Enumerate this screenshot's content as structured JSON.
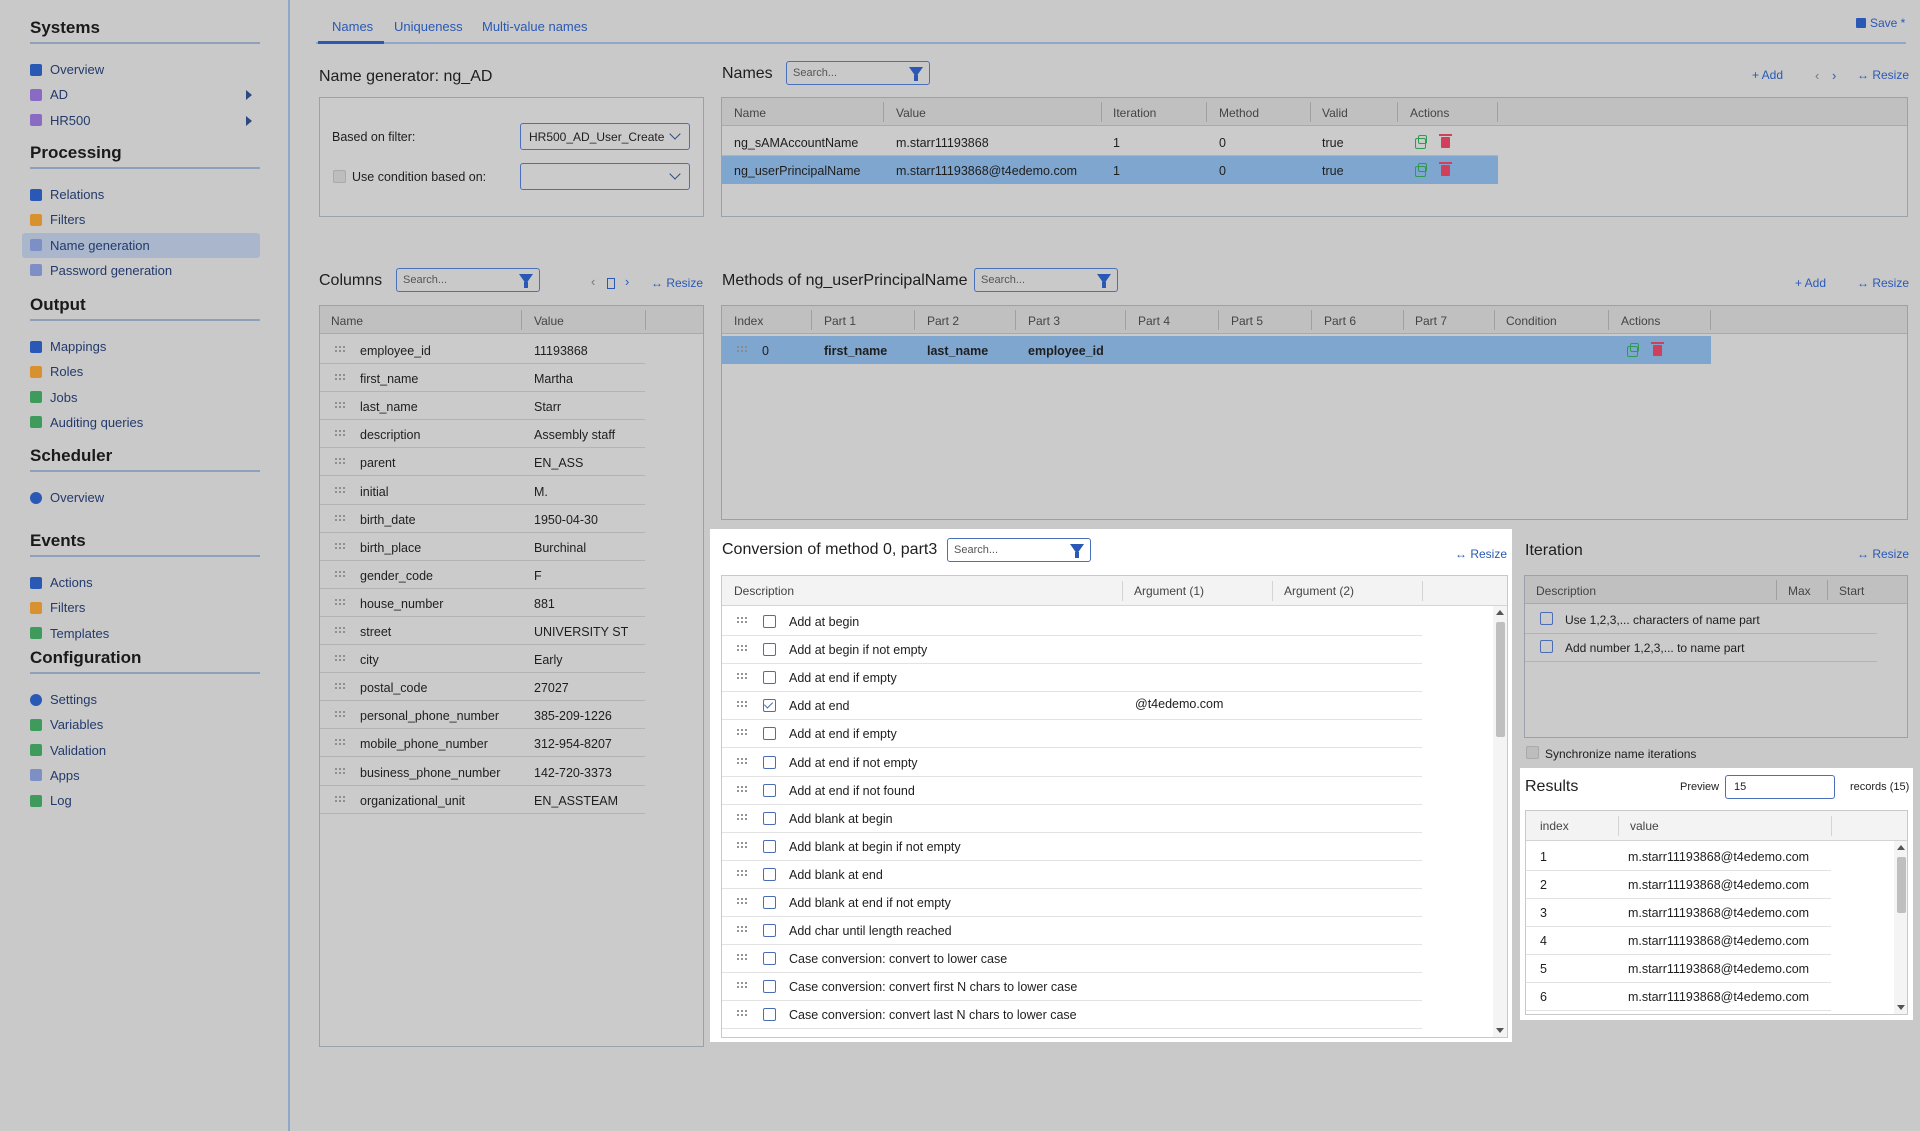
{
  "sidebar": {
    "sections": [
      {
        "title": "Systems",
        "items": [
          {
            "label": "Overview",
            "icon": "wrench-icon"
          },
          {
            "label": "AD",
            "icon": "users-icon",
            "arrow": true
          },
          {
            "label": "HR500",
            "icon": "users-icon",
            "arrow": true
          }
        ]
      },
      {
        "title": "Processing",
        "items": [
          {
            "label": "Relations",
            "icon": "relations-icon"
          },
          {
            "label": "Filters",
            "icon": "filter-icon"
          },
          {
            "label": "Name generation",
            "icon": "edit-icon",
            "active": true
          },
          {
            "label": "Password generation",
            "icon": "edit-icon"
          }
        ]
      },
      {
        "title": "Output",
        "items": [
          {
            "label": "Mappings",
            "icon": "mapping-icon"
          },
          {
            "label": "Roles",
            "icon": "filter-icon"
          },
          {
            "label": "Jobs",
            "icon": "document-icon"
          },
          {
            "label": "Auditing queries",
            "icon": "document-icon"
          }
        ]
      },
      {
        "title": "Scheduler",
        "items": [
          {
            "label": "Overview",
            "icon": "clock-icon"
          }
        ]
      },
      {
        "title": "Events",
        "items": [
          {
            "label": "Actions",
            "icon": "wrench-icon"
          },
          {
            "label": "Filters",
            "icon": "filter-icon"
          },
          {
            "label": "Templates",
            "icon": "document-icon"
          }
        ]
      },
      {
        "title": "Configuration",
        "items": [
          {
            "label": "Settings",
            "icon": "gear-icon"
          },
          {
            "label": "Variables",
            "icon": "document-icon"
          },
          {
            "label": "Validation",
            "icon": "document-icon"
          },
          {
            "label": "Apps",
            "icon": "edit-icon"
          },
          {
            "label": "Log",
            "icon": "document-icon"
          }
        ]
      }
    ]
  },
  "tabs": [
    "Names",
    "Uniqueness",
    "Multi-value names"
  ],
  "save_label": "Save *",
  "generator": {
    "title": "Name generator: ng_AD",
    "based_on_filter_label": "Based on filter:",
    "based_on_filter_value": "HR500_AD_User_Create",
    "use_condition_label": "Use condition based on:",
    "use_condition_value": ""
  },
  "names": {
    "title": "Names",
    "search_placeholder": "Search...",
    "add_label": "+ Add",
    "resize_label": "↔ Resize",
    "headers": [
      "Name",
      "Value",
      "Iteration",
      "Method",
      "Valid",
      "Actions"
    ],
    "rows": [
      {
        "name": "ng_sAMAccountName",
        "value": "m.starr11193868",
        "iteration": "1",
        "method": "0",
        "valid": "true"
      },
      {
        "name": "ng_userPrincipalName",
        "value": "m.starr11193868@t4edemo.com",
        "iteration": "1",
        "method": "0",
        "valid": "true",
        "selected": true
      }
    ]
  },
  "columns": {
    "title": "Columns",
    "search_placeholder": "Search...",
    "resize_label": "↔ Resize",
    "headers": [
      "Name",
      "Value"
    ],
    "rows": [
      [
        "employee_id",
        "11193868"
      ],
      [
        "first_name",
        "Martha"
      ],
      [
        "last_name",
        "Starr"
      ],
      [
        "description",
        "Assembly staff"
      ],
      [
        "parent",
        "EN_ASS"
      ],
      [
        "initial",
        "M."
      ],
      [
        "birth_date",
        "1950-04-30"
      ],
      [
        "birth_place",
        "Burchinal"
      ],
      [
        "gender_code",
        "F"
      ],
      [
        "house_number",
        "881"
      ],
      [
        "street",
        "UNIVERSITY ST"
      ],
      [
        "city",
        "Early"
      ],
      [
        "postal_code",
        "27027"
      ],
      [
        "personal_phone_number",
        "385-209-1226"
      ],
      [
        "mobile_phone_number",
        "312-954-8207"
      ],
      [
        "business_phone_number",
        "142-720-3373"
      ],
      [
        "organizational_unit",
        "EN_ASSTEAM"
      ]
    ]
  },
  "methods": {
    "title": "Methods of ng_userPrincipalName",
    "search_placeholder": "Search...",
    "add_label": "+ Add",
    "resize_label": "↔ Resize",
    "headers": [
      "Index",
      "Part 1",
      "Part 2",
      "Part 3",
      "Part 4",
      "Part 5",
      "Part 6",
      "Part 7",
      "Condition",
      "Actions"
    ],
    "rows": [
      {
        "index": "0",
        "part1": "first_name",
        "part2": "last_name",
        "part3": "employee_id"
      }
    ]
  },
  "conversion": {
    "title": "Conversion of method 0, part3",
    "search_placeholder": "Search...",
    "resize_label": "↔ Resize",
    "headers": [
      "Description",
      "Argument (1)",
      "Argument (2)"
    ],
    "rows": [
      {
        "desc": "Add at begin",
        "checked": false,
        "arg1": ""
      },
      {
        "desc": "Add at begin if not empty",
        "checked": false,
        "arg1": ""
      },
      {
        "desc": "Add at end if empty",
        "checked": false,
        "arg1": ""
      },
      {
        "desc": "Add at end",
        "checked": true,
        "arg1": "@t4edemo.com"
      },
      {
        "desc": "Add at end if empty",
        "checked": false,
        "arg1": ""
      },
      {
        "desc": "Add at end if not empty",
        "checked": false,
        "arg1": ""
      },
      {
        "desc": "Add at end if not found",
        "checked": false,
        "arg1": ""
      },
      {
        "desc": "Add blank at begin",
        "checked": false,
        "arg1": ""
      },
      {
        "desc": "Add blank at begin if not empty",
        "checked": false,
        "arg1": ""
      },
      {
        "desc": "Add blank at end",
        "checked": false,
        "arg1": ""
      },
      {
        "desc": "Add blank at end if not empty",
        "checked": false,
        "arg1": ""
      },
      {
        "desc": "Add char until length reached",
        "checked": false,
        "arg1": ""
      },
      {
        "desc": "Case conversion: convert to lower case",
        "checked": false,
        "arg1": ""
      },
      {
        "desc": "Case conversion: convert first N chars to lower case",
        "checked": false,
        "arg1": ""
      },
      {
        "desc": "Case conversion: convert last N chars to lower case",
        "checked": false,
        "arg1": ""
      }
    ]
  },
  "iteration": {
    "title": "Iteration",
    "resize_label": "↔ Resize",
    "headers": [
      "Description",
      "Max",
      "Start"
    ],
    "rows": [
      {
        "desc": "Use 1,2,3,... characters of name part"
      },
      {
        "desc": "Add number 1,2,3,... to name part"
      }
    ],
    "sync_label": "Synchronize name iterations"
  },
  "results": {
    "title": "Results",
    "preview_label": "Preview",
    "preview_value": "15",
    "records_label": "records (15)",
    "headers": [
      "index",
      "value"
    ],
    "rows": [
      [
        "1",
        "m.starr11193868@t4edemo.com"
      ],
      [
        "2",
        "m.starr11193868@t4edemo.com"
      ],
      [
        "3",
        "m.starr11193868@t4edemo.com"
      ],
      [
        "4",
        "m.starr11193868@t4edemo.com"
      ],
      [
        "5",
        "m.starr11193868@t4edemo.com"
      ],
      [
        "6",
        "m.starr11193868@t4edemo.com"
      ]
    ]
  },
  "colors": {
    "accent": "#2a59b5",
    "selected_row": "#7fa6cf",
    "sidebar_active": "#a9b6cc"
  }
}
